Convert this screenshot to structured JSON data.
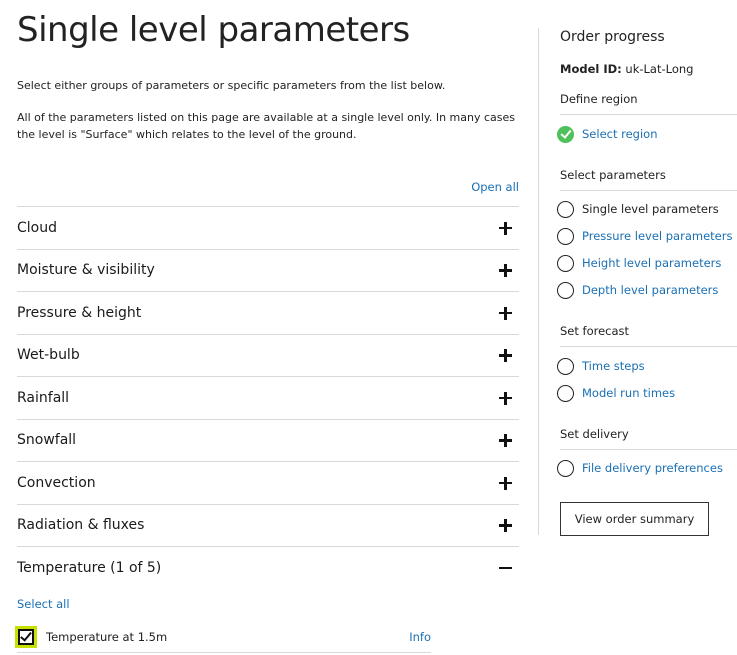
{
  "main": {
    "title": "Single level parameters",
    "intro": "Select either groups of parameters or specific parameters from the list below.",
    "intro2": "All of the parameters listed on this page are available at a single level only. In many cases the level is \"Surface\" which relates to the level of the ground.",
    "open_all": "Open all",
    "groups": [
      {
        "label": "Cloud",
        "expanded": false
      },
      {
        "label": "Moisture & visibility",
        "expanded": false
      },
      {
        "label": "Pressure & height",
        "expanded": false
      },
      {
        "label": "Wet-bulb",
        "expanded": false
      },
      {
        "label": "Rainfall",
        "expanded": false
      },
      {
        "label": "Snowfall",
        "expanded": false
      },
      {
        "label": "Convection",
        "expanded": false
      },
      {
        "label": "Radiation & fluxes",
        "expanded": false
      },
      {
        "label": "Temperature  (1 of 5)",
        "expanded": true
      }
    ],
    "select_all": "Select all",
    "parameters": [
      {
        "label": "Temperature at 1.5m",
        "checked": true,
        "info": "Info"
      }
    ]
  },
  "sidebar": {
    "title": "Order progress",
    "model_id_key": "Model ID:",
    "model_id_value": "uk-Lat-Long",
    "sections": [
      {
        "heading": "Define region",
        "steps": [
          {
            "label": "Select region",
            "status": "done"
          }
        ]
      },
      {
        "heading": "Select parameters",
        "steps": [
          {
            "label": "Single level parameters",
            "status": "current"
          },
          {
            "label": "Pressure level parameters",
            "status": "todo"
          },
          {
            "label": "Height level parameters",
            "status": "todo"
          },
          {
            "label": "Depth level parameters",
            "status": "todo"
          }
        ]
      },
      {
        "heading": "Set forecast",
        "steps": [
          {
            "label": "Time steps",
            "status": "todo"
          },
          {
            "label": "Model run times",
            "status": "todo"
          }
        ]
      },
      {
        "heading": "Set delivery",
        "steps": [
          {
            "label": "File delivery preferences",
            "status": "todo"
          }
        ]
      }
    ],
    "summary_button": "View order summary"
  },
  "colors": {
    "link": "#1a6fb3",
    "done": "#4fc15a",
    "focus": "#c8e000"
  }
}
